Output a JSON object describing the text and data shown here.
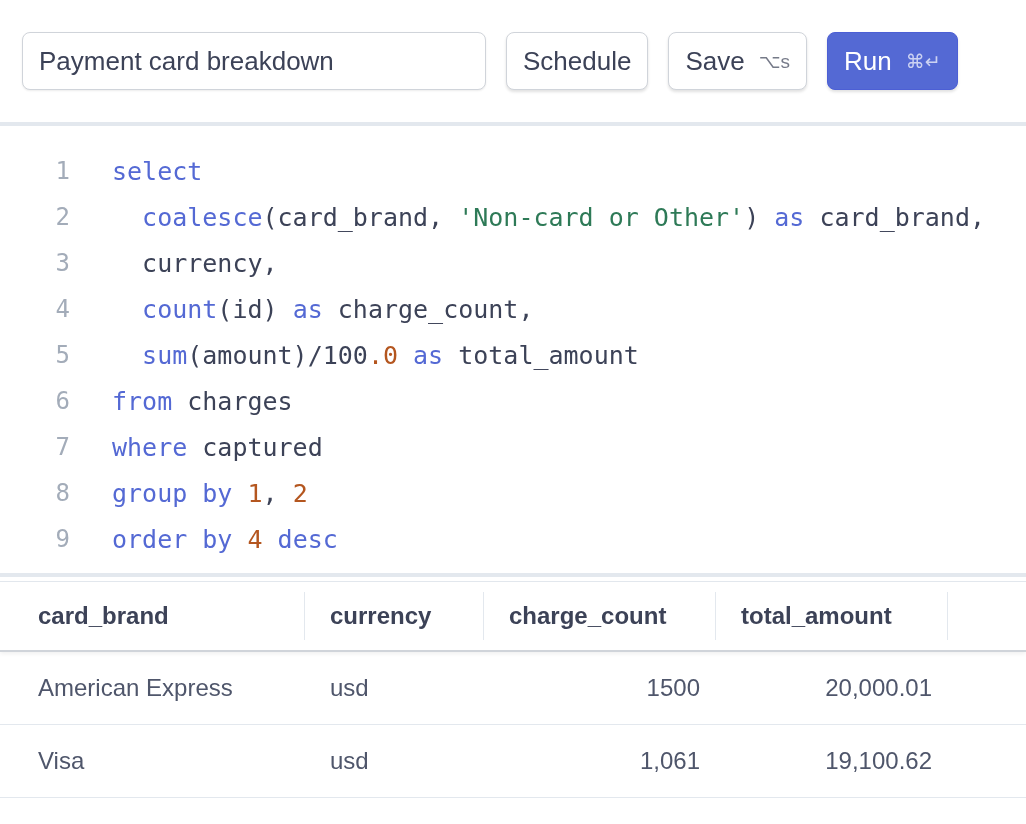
{
  "toolbar": {
    "query_name": "Payment card breakdown",
    "buttons": [
      {
        "kind": "secondary",
        "label": "Schedule"
      },
      {
        "kind": "secondary",
        "label": "Save",
        "shortcut": "⌥s"
      },
      {
        "kind": "primary",
        "label": "Run",
        "shortcut": "⌘↵"
      }
    ]
  },
  "editor": {
    "lines": [
      {
        "number": "1",
        "tokens": [
          {
            "kind": "keyword",
            "text": "select"
          }
        ]
      },
      {
        "number": "2",
        "tokens": [
          {
            "kind": "keyword",
            "text": "  coalesce"
          },
          {
            "kind": "plain",
            "text": "(card_brand, "
          },
          {
            "kind": "string",
            "text": "'Non-card or Other'"
          },
          {
            "kind": "plain",
            "text": ") "
          },
          {
            "kind": "keyword",
            "text": "as"
          },
          {
            "kind": "plain",
            "text": " card_brand,"
          }
        ]
      },
      {
        "number": "3",
        "tokens": [
          {
            "kind": "plain",
            "text": "  currency,"
          }
        ]
      },
      {
        "number": "4",
        "tokens": [
          {
            "kind": "keyword",
            "text": "  count"
          },
          {
            "kind": "plain",
            "text": "(id) "
          },
          {
            "kind": "keyword",
            "text": "as"
          },
          {
            "kind": "plain",
            "text": " charge_count,"
          }
        ]
      },
      {
        "number": "5",
        "tokens": [
          {
            "kind": "keyword",
            "text": "  sum"
          },
          {
            "kind": "plain",
            "text": "(amount)/100"
          },
          {
            "kind": "number",
            "text": ".0"
          },
          {
            "kind": "keyword",
            "text": " as"
          },
          {
            "kind": "plain",
            "text": " total_amount"
          }
        ]
      },
      {
        "number": "6",
        "tokens": [
          {
            "kind": "keyword",
            "text": "from"
          },
          {
            "kind": "plain",
            "text": " charges"
          }
        ]
      },
      {
        "number": "7",
        "tokens": [
          {
            "kind": "keyword",
            "text": "where"
          },
          {
            "kind": "plain",
            "text": " captured"
          }
        ]
      },
      {
        "number": "8",
        "tokens": [
          {
            "kind": "keyword",
            "text": "group by "
          },
          {
            "kind": "number",
            "text": "1"
          },
          {
            "kind": "plain",
            "text": ", "
          },
          {
            "kind": "number",
            "text": "2"
          }
        ]
      },
      {
        "number": "9",
        "tokens": [
          {
            "kind": "keyword",
            "text": "order by "
          },
          {
            "kind": "number",
            "text": "4"
          },
          {
            "kind": "keyword",
            "text": " desc"
          }
        ]
      }
    ]
  },
  "results": {
    "columns": [
      {
        "label": "card_brand",
        "numeric": false
      },
      {
        "label": "currency",
        "numeric": false
      },
      {
        "label": "charge_count",
        "numeric": true
      },
      {
        "label": "total_amount",
        "numeric": true
      }
    ],
    "rows": [
      [
        "American Express",
        "usd",
        "1500",
        "20,000.01"
      ],
      [
        "Visa",
        "usd",
        "1,061",
        "19,100.62"
      ]
    ]
  }
}
